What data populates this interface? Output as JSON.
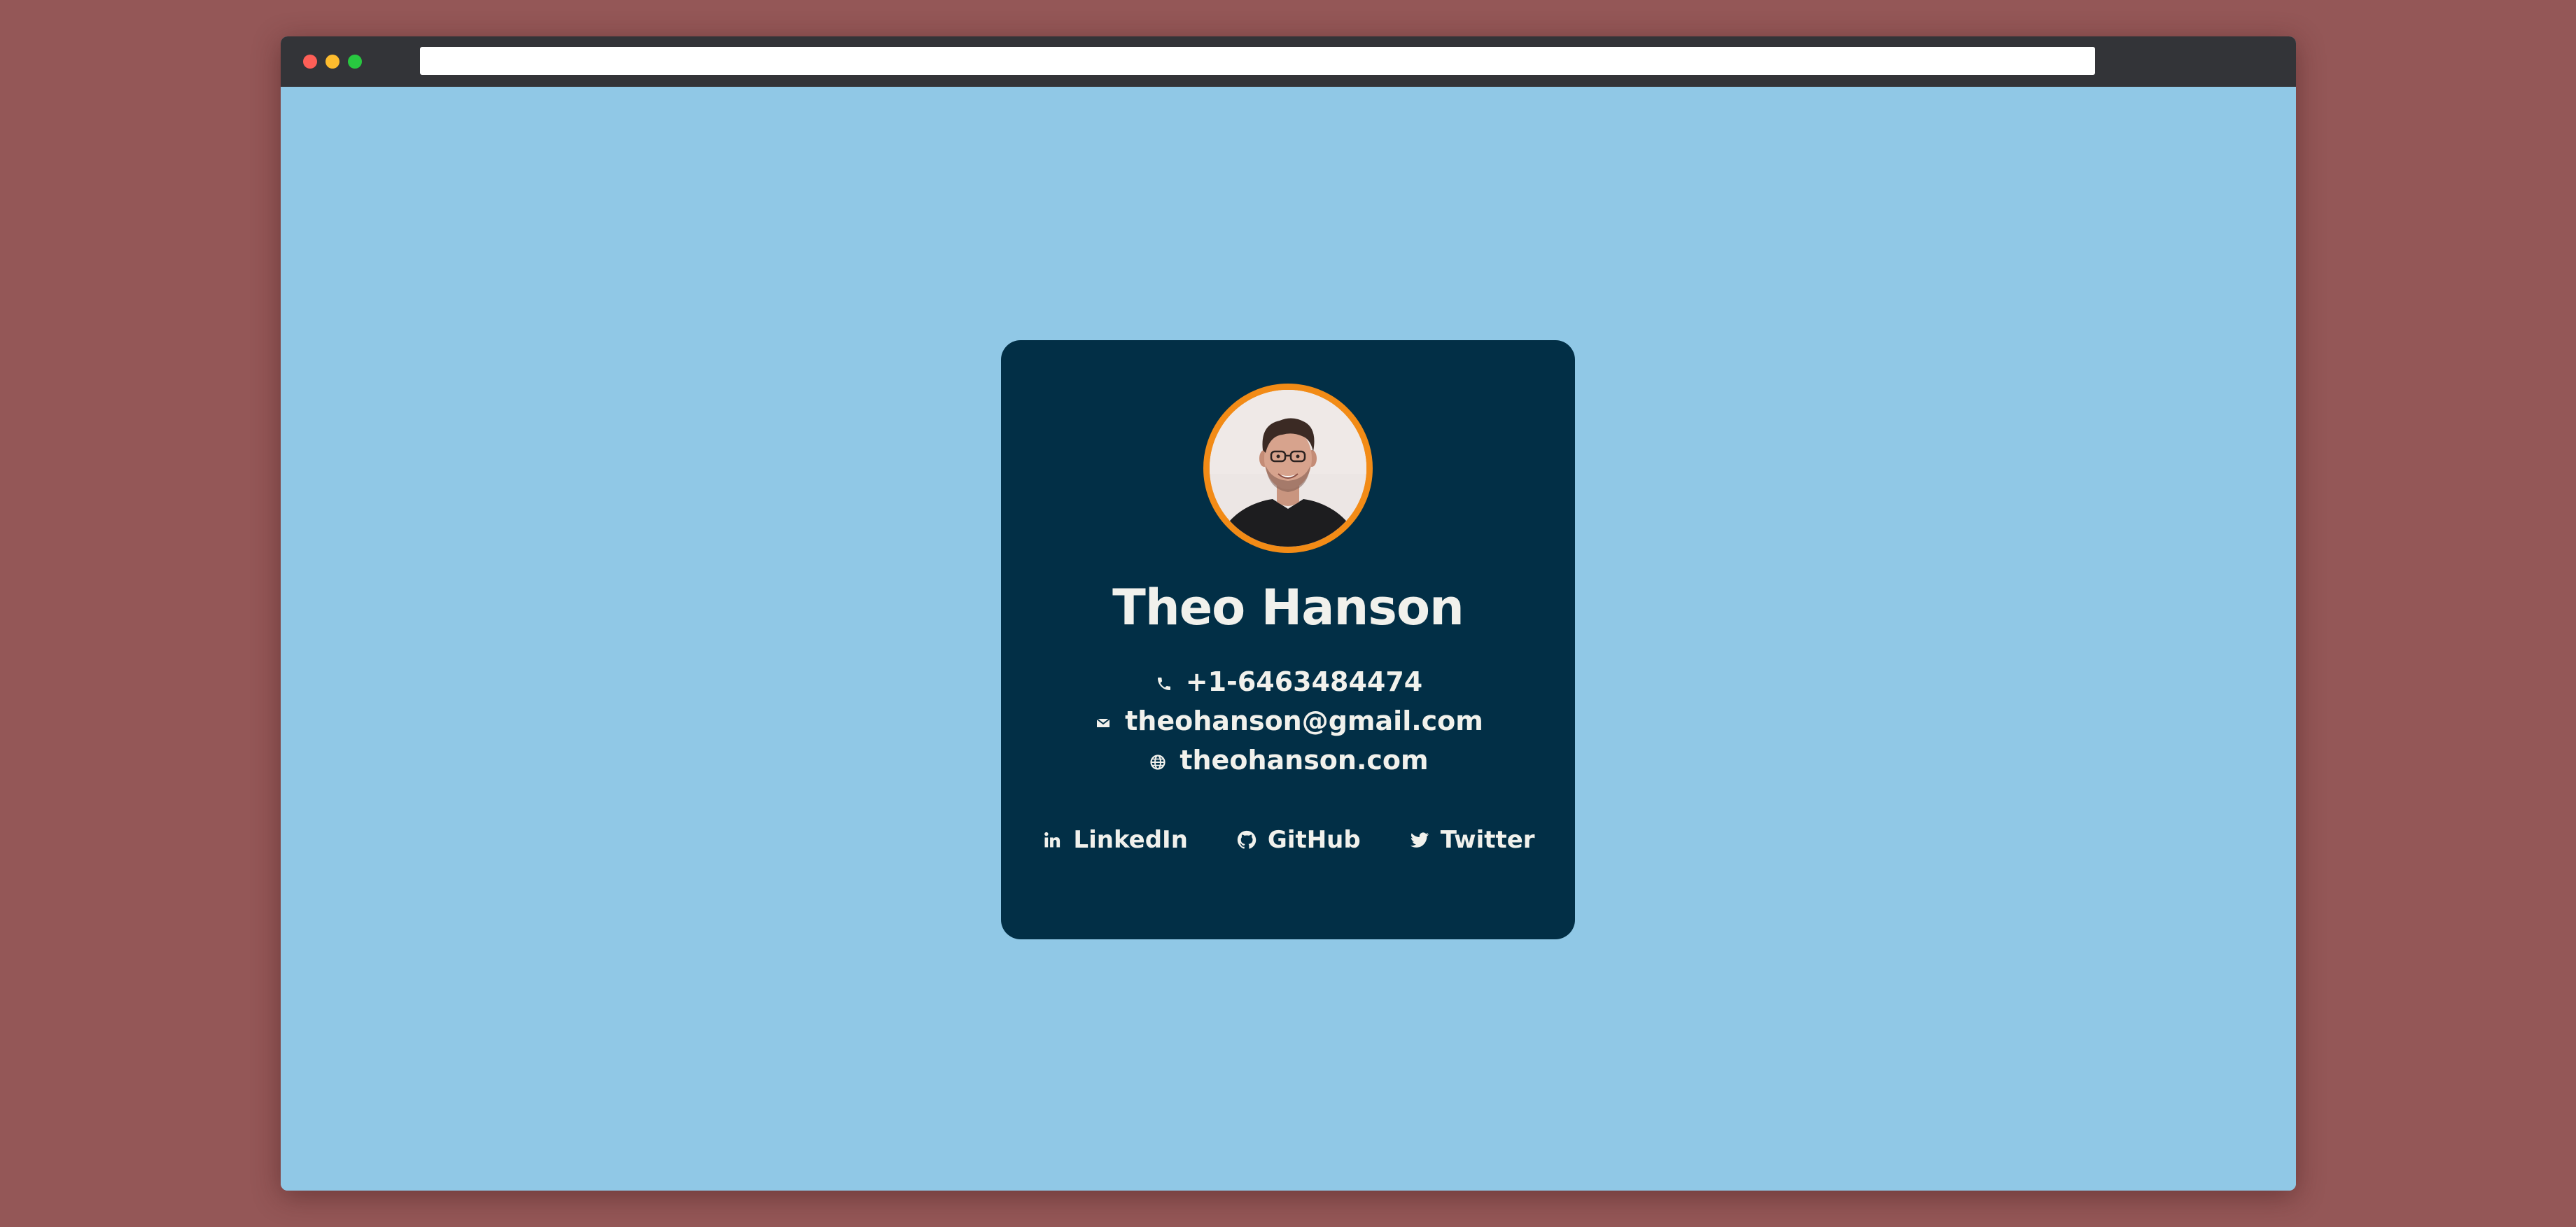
{
  "colors": {
    "desktop_background": "#945757",
    "window_chrome": "#333438",
    "page_background": "#90c8e6",
    "card_background": "#022f46",
    "card_text": "#f1f1ec",
    "avatar_ring": "#f28b16",
    "traffic_close": "#fe5f57",
    "traffic_minimize": "#febc2e",
    "traffic_maximize": "#28c840"
  },
  "browser": {
    "address_value": ""
  },
  "profile": {
    "name": "Theo Hanson",
    "avatar_icon": "profile-photo"
  },
  "contacts": [
    {
      "icon": "phone-icon",
      "text": "+1-6463484474"
    },
    {
      "icon": "mail-icon",
      "text": "theohanson@gmail.com"
    },
    {
      "icon": "globe-icon",
      "text": "theohanson.com"
    }
  ],
  "socials": [
    {
      "icon": "linkedin-icon",
      "label": "LinkedIn"
    },
    {
      "icon": "github-icon",
      "label": "GitHub"
    },
    {
      "icon": "twitter-icon",
      "label": "Twitter"
    }
  ]
}
